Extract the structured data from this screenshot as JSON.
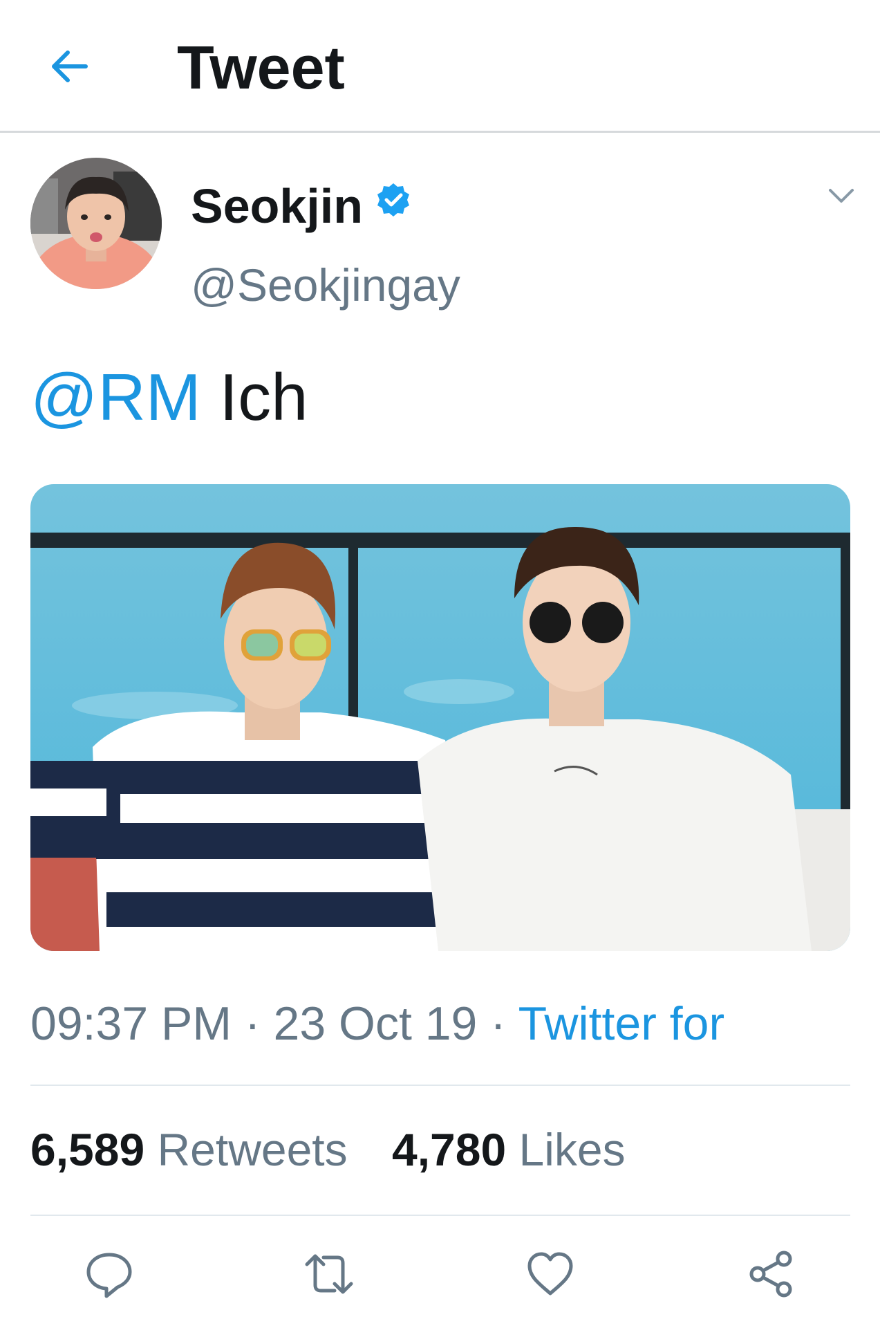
{
  "colors": {
    "accent": "#1b95e0",
    "text_primary": "#14171a",
    "text_secondary": "#657786",
    "divider": "#e1e8ed"
  },
  "header": {
    "back_icon": "arrow-left-icon",
    "title": "Tweet"
  },
  "tweet": {
    "author": {
      "display_name": "Seokjin",
      "verified_icon": "verified-badge-icon",
      "handle": "@Seokjingay"
    },
    "menu_icon": "chevron-down-icon",
    "text_mention": "@RM",
    "text_body": "Ich",
    "timestamp_time": "09:37 PM",
    "timestamp_sep1": "·",
    "timestamp_date": "23 Oct 19",
    "timestamp_sep2": "·",
    "source": "Twitter for",
    "stats": {
      "retweets_count": "6,589",
      "retweets_label": "Retweets",
      "likes_count": "4,780",
      "likes_label": "Likes"
    },
    "actions": [
      "reply-icon",
      "retweet-icon",
      "like-heart-icon",
      "share-icon"
    ]
  }
}
